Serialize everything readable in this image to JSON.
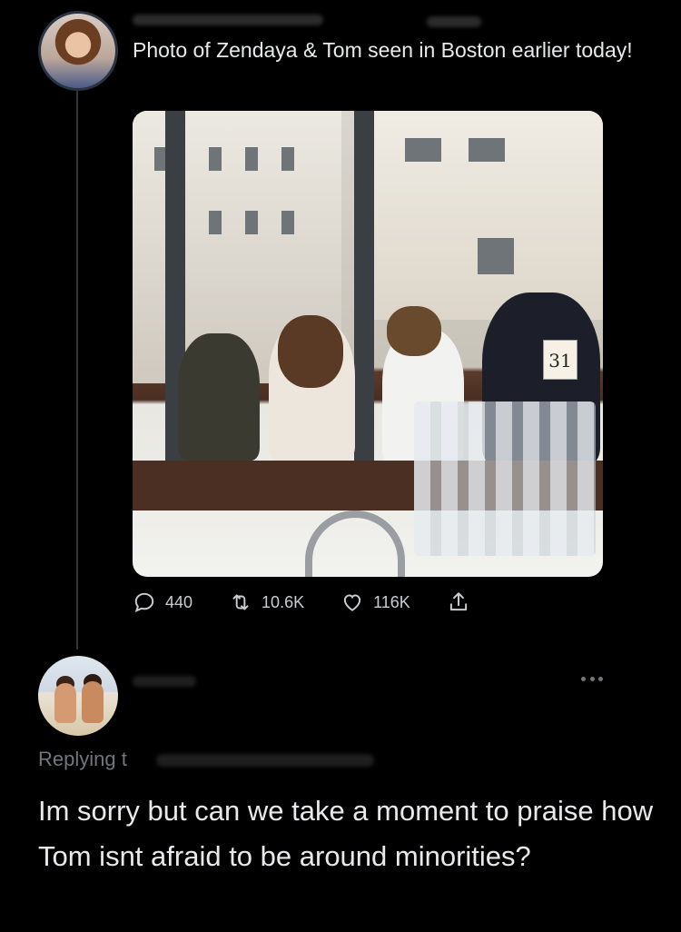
{
  "tweet": {
    "text": "Photo of Zendaya & Tom seen in Boston earlier today!",
    "photo": {
      "table_sign": "31"
    },
    "actions": {
      "replies": "440",
      "retweets": "10.6K",
      "likes": "116K"
    }
  },
  "reply": {
    "replying_label": "Replying t",
    "text": "Im sorry but can we take a moment to praise how Tom isnt afraid to be around minorities?"
  },
  "icons": [
    "reply-icon",
    "retweet-icon",
    "like-icon",
    "share-icon",
    "more-icon"
  ],
  "colors": {
    "background": "#000000",
    "text": "#e7e9ea",
    "muted": "#71767b",
    "thread_line": "#333639"
  }
}
